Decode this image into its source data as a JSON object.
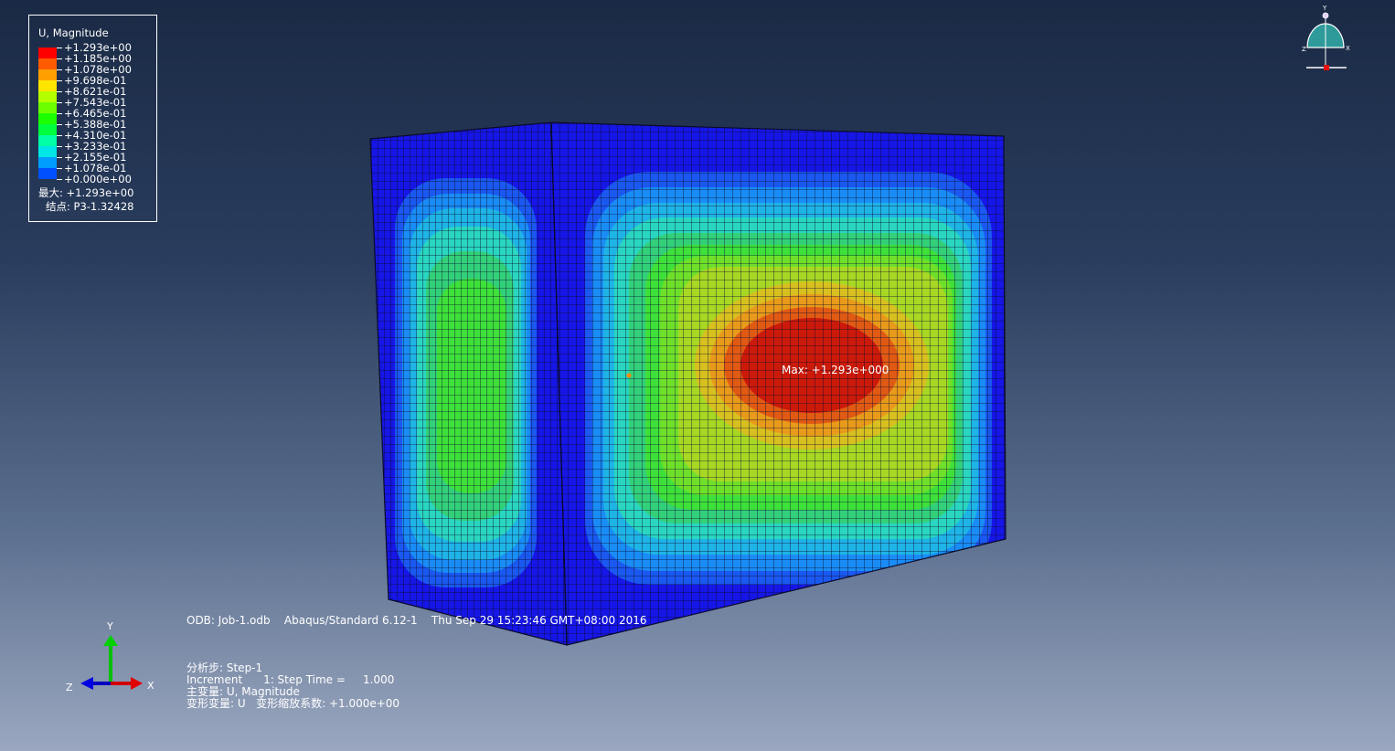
{
  "legend": {
    "title": "U, Magnitude",
    "labels": [
      "+1.293e+00",
      "+1.185e+00",
      "+1.078e+00",
      "+9.698e-01",
      "+8.621e-01",
      "+7.543e-01",
      "+6.465e-01",
      "+5.388e-01",
      "+4.310e-01",
      "+3.233e-01",
      "+2.155e-01",
      "+1.078e-01",
      "+0.000e+00"
    ],
    "colors": [
      "#ff0000",
      "#ff5a00",
      "#ffa000",
      "#ffe600",
      "#b4ff00",
      "#6cff00",
      "#1cff00",
      "#00ff3c",
      "#00ffa6",
      "#00e6e6",
      "#009cff",
      "#0050ff",
      "#0000ff"
    ],
    "max_line": "最大: +1.293e+00",
    "node_line": "结点: P3-1.32428"
  },
  "viewport": {
    "max_label": "Max: +1.293e+000"
  },
  "info": {
    "odb_line": "ODB: Job-1.odb    Abaqus/Standard 6.12-1    Thu Sep 29 15:23:46 GMT+08:00 2016",
    "step_line": "分析步: Step-1",
    "increment_line": "Increment      1: Step Time =     1.000",
    "primary_var_line": "主变量: U, Magnitude",
    "deformed_var_line": "变形变量: U   变形缩放系数: +1.000e+00"
  },
  "triad": {
    "x_label": "X",
    "y_label": "Y",
    "z_label": "Z"
  },
  "orientation": {
    "x_label": "X",
    "y_label": "Y",
    "z_label": "Z"
  }
}
